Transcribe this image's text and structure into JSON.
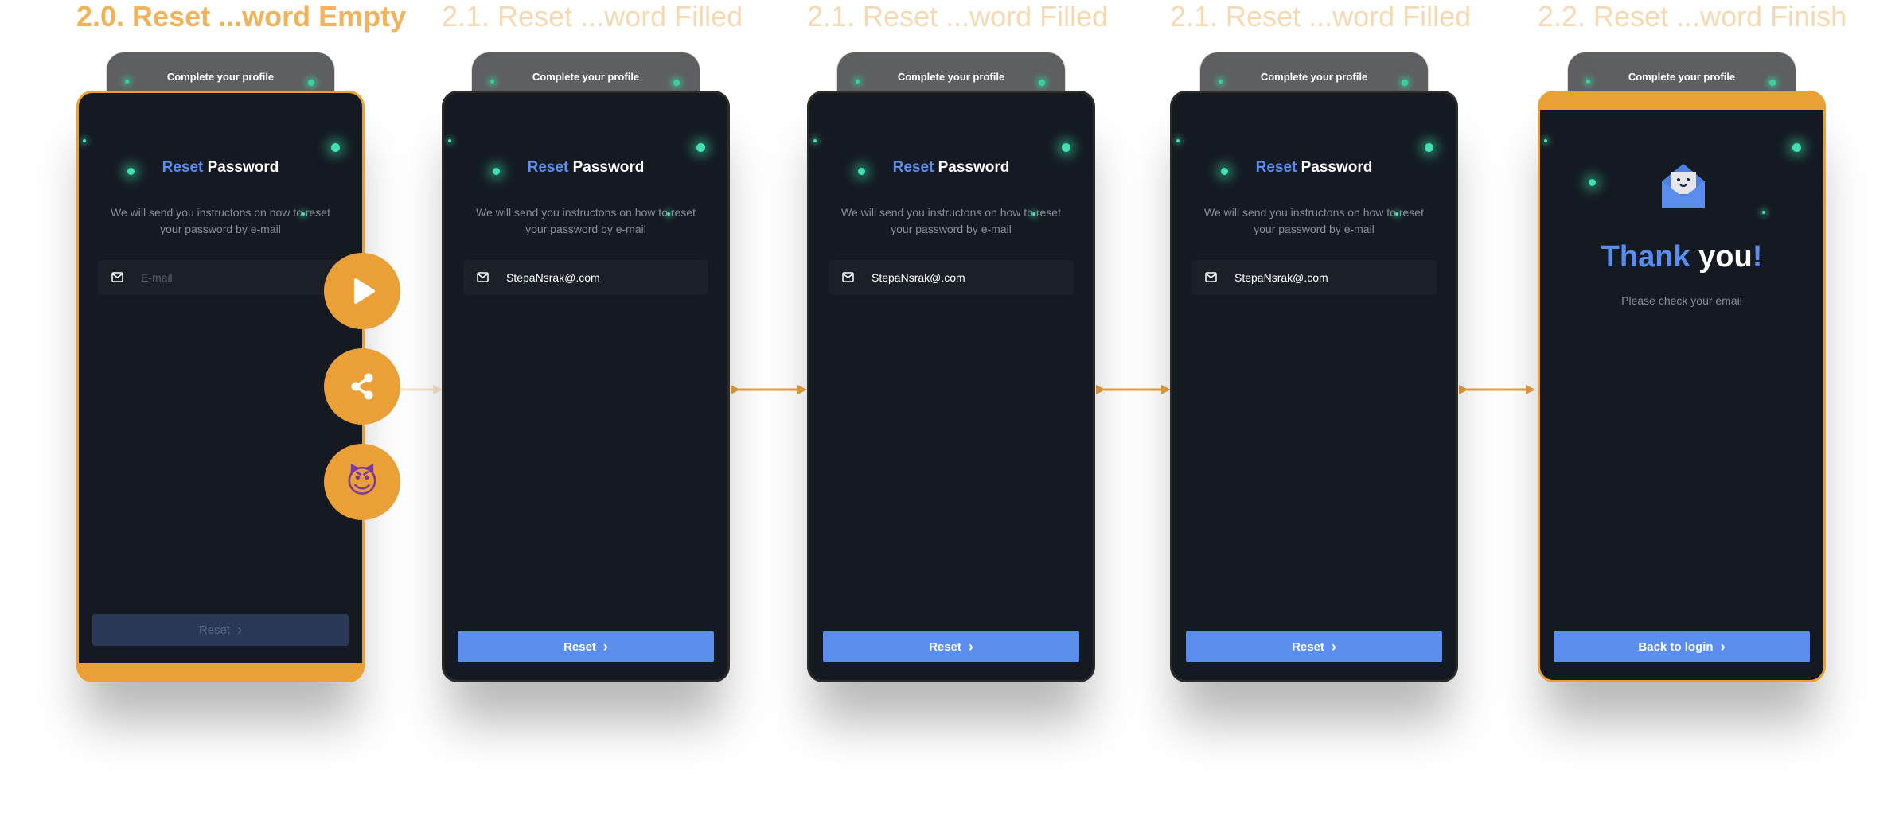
{
  "frames": [
    {
      "title": "2.0. Reset ...word Empty",
      "tab": "Complete your profile",
      "heading_accent": "Reset",
      "heading_rest": " Password",
      "description": "We will send you instructons on how to reset your password by e-mail",
      "input_placeholder": "E-mail",
      "button": "Reset"
    },
    {
      "title": "2.1. Reset ...word Filled",
      "tab": "Complete your profile",
      "heading_accent": "Reset",
      "heading_rest": " Password",
      "description": "We will send you instructons on how to reset your password by e-mail",
      "input_value": "StepaNsrak@.com",
      "button": "Reset"
    },
    {
      "title": "2.1. Reset ...word Filled",
      "tab": "Complete your profile",
      "heading_accent": "Reset",
      "heading_rest": " Password",
      "description": "We will send you instructons on how to reset your password by e-mail",
      "input_value": "StepaNsrak@.com",
      "button": "Reset"
    },
    {
      "title": "2.1. Reset ...word Filled",
      "tab": "Complete your profile",
      "heading_accent": "Reset",
      "heading_rest": " Password",
      "description": "We will send you instructons on how to reset your password by e-mail",
      "input_value": "StepaNsrak@.com",
      "button": "Reset"
    },
    {
      "title": "2.2. Reset ...word Finish",
      "tab": "Complete your profile",
      "thank_accent": "Thank",
      "thank_rest": " you",
      "thank_punct": "!",
      "subtitle": "Please check your email",
      "button": "Back to login"
    }
  ],
  "fabs": {
    "play_icon": "play-icon",
    "share_icon": "share-icon",
    "emoji": "😈"
  },
  "colors": {
    "accent_orange": "#ea9f37",
    "accent_blue": "#5b8def",
    "screen_bg": "#151a22",
    "glow_green": "#41e0b0"
  }
}
